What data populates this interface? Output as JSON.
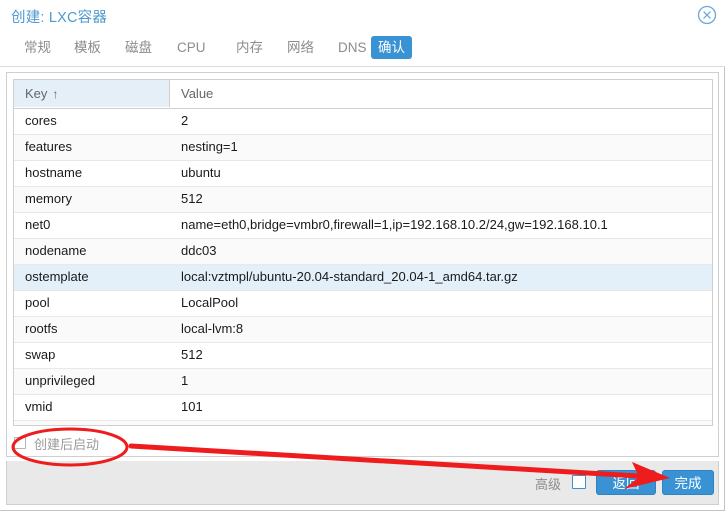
{
  "window": {
    "title": "创建: LXC容器",
    "close_icon": "close-circle-icon"
  },
  "tabs": [
    {
      "label": "常规",
      "active": false
    },
    {
      "label": "模板",
      "active": false
    },
    {
      "label": "磁盘",
      "active": false
    },
    {
      "label": "CPU",
      "active": false
    },
    {
      "label": "内存",
      "active": false
    },
    {
      "label": "网络",
      "active": false
    },
    {
      "label": "DNS",
      "active": false
    },
    {
      "label": "确认",
      "active": true
    }
  ],
  "grid": {
    "columns": [
      {
        "label": "Key",
        "sort": "↑"
      },
      {
        "label": "Value",
        "sort": ""
      }
    ],
    "rows": [
      {
        "key": "cores",
        "value": "2"
      },
      {
        "key": "features",
        "value": "nesting=1"
      },
      {
        "key": "hostname",
        "value": "ubuntu"
      },
      {
        "key": "memory",
        "value": "512"
      },
      {
        "key": "net0",
        "value": "name=eth0,bridge=vmbr0,firewall=1,ip=192.168.10.2/24,gw=192.168.10.1"
      },
      {
        "key": "nodename",
        "value": "ddc03"
      },
      {
        "key": "ostemplate",
        "value": "local:vztmpl/ubuntu-20.04-standard_20.04-1_amd64.tar.gz"
      },
      {
        "key": "pool",
        "value": "LocalPool"
      },
      {
        "key": "rootfs",
        "value": "local-lvm:8"
      },
      {
        "key": "swap",
        "value": "512"
      },
      {
        "key": "unprivileged",
        "value": "1"
      },
      {
        "key": "vmid",
        "value": "101"
      }
    ],
    "selected_index": 6
  },
  "start_after_create": {
    "label": "创建后启动",
    "checked": false,
    "disabled": true
  },
  "footer": {
    "advanced_label": "高级",
    "advanced_checked": false,
    "back_label": "返回",
    "finish_label": "完成"
  },
  "annotation": {
    "highlight_color": "#ee1c1c",
    "ellipse_target": "创建后启动",
    "arrow_target": "完成"
  },
  "colors": {
    "accent": "#3892d4",
    "title": "#4f9ad0",
    "selected_row": "#e4f0f9",
    "header_key": "#e4eff7",
    "footer": "#e9e9e9",
    "annotation_red": "#ee1c1c"
  }
}
